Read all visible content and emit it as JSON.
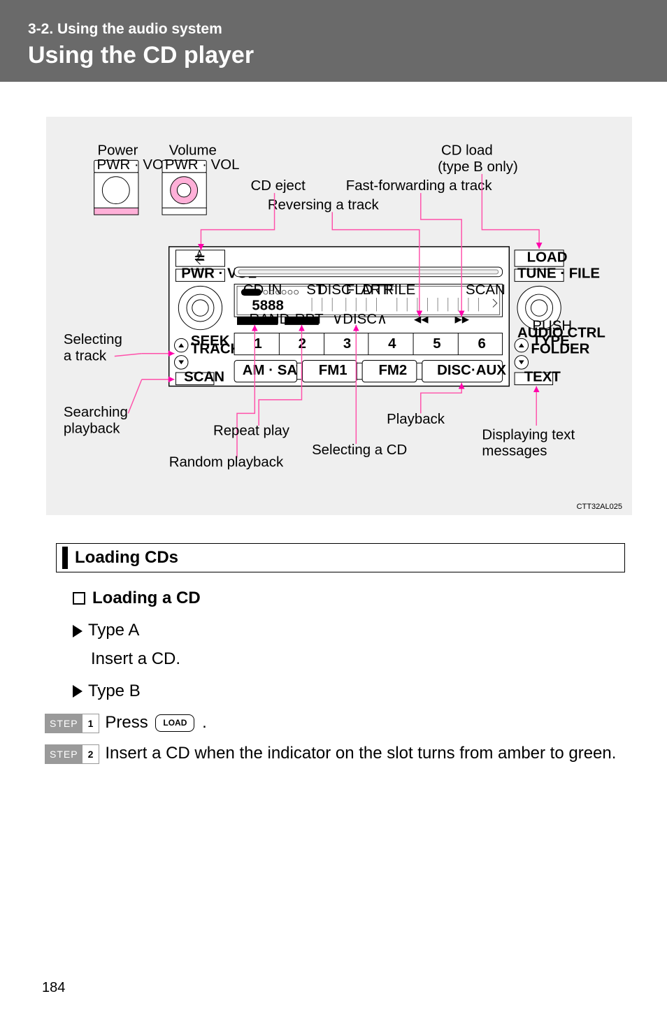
{
  "header": {
    "section_label": "3-2. Using the audio system",
    "title": "Using the CD player"
  },
  "diagram": {
    "labels": {
      "power": "Power",
      "volume": "Volume",
      "cd_load": "CD load",
      "cd_load_sub": "(type B only)",
      "cd_eject": "CD eject",
      "fast_forward": "Fast-forwarding a track",
      "reversing": "Reversing a track",
      "selecting_track_l1": "Selecting",
      "selecting_track_l2": "a track",
      "searching_l1": "Searching",
      "searching_l2": "playback",
      "repeat_play": "Repeat play",
      "random_playback": "Random playback",
      "selecting_cd": "Selecting a CD",
      "playback": "Playback",
      "displaying_text_l1": "Displaying text",
      "displaying_text_l2": "messages"
    },
    "unit": {
      "pwr_vol": "PWR · VOL",
      "load": "LOAD",
      "tune_file": "TUNE · FILE",
      "audio_ctrl": "AUDIO CTRL",
      "push": "PUSH",
      "seek_track_l1": "SEEK",
      "seek_track_l2": "TRACK",
      "type_folder_l1": "TYPE",
      "type_folder_l2": "FOLDER",
      "scan": "SCAN",
      "text": "TEXT",
      "rand": "RAND",
      "rpt": "RPT",
      "disc_arrows": "∨DISC∧",
      "display_segs": "5888",
      "cd_in": "CD IN",
      "scan_ind": "SCAN",
      "st": "ST",
      "disc_s": "DISC",
      "fld": "FLD",
      "art": "ART",
      "tr": "TR",
      "file": "FILE",
      "buttons": {
        "b1": "1",
        "b2": "2",
        "b3": "3",
        "b4": "4",
        "b5": "5",
        "b6": "6"
      },
      "am_sat": "AM · SAT",
      "fm1": "FM1",
      "fm2": "FM2",
      "disc_aux": "DISC·AUX"
    },
    "code_id": "CTT32AL025"
  },
  "content": {
    "loading_cds_heading": "Loading CDs",
    "loading_a_cd": "Loading a CD",
    "type_a": "Type A",
    "insert_a_cd": "Insert a CD.",
    "type_b": "Type B",
    "step_label": "STEP",
    "step1_num": "1",
    "step1_text_pre": "Press ",
    "load_button": "LOAD",
    "step1_text_post": " .",
    "step2_num": "2",
    "step2_text": "Insert a CD when the indicator on the slot turns from amber to green."
  },
  "page_number": "184"
}
